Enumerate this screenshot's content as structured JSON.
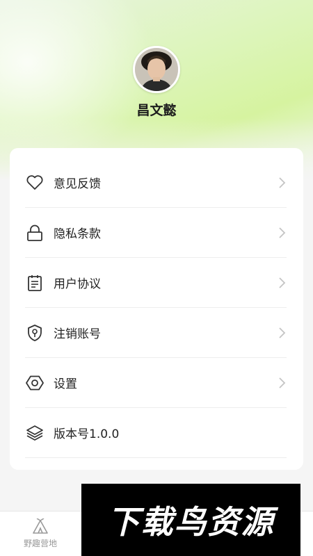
{
  "profile": {
    "name": "昌文懿"
  },
  "menu": [
    {
      "label": "意见反馈",
      "icon": "heart-icon",
      "chevron": true
    },
    {
      "label": "隐私条款",
      "icon": "lock-icon",
      "chevron": true
    },
    {
      "label": "用户协议",
      "icon": "document-icon",
      "chevron": true
    },
    {
      "label": "注销账号",
      "icon": "shield-key-icon",
      "chevron": true
    },
    {
      "label": "设置",
      "icon": "hexagon-settings-icon",
      "chevron": true
    },
    {
      "label": "版本号1.0.0",
      "icon": "layers-icon",
      "chevron": false
    }
  ],
  "tabbar": {
    "tabs": [
      {
        "label": "野趣营地",
        "icon": "tent-icon"
      }
    ]
  },
  "watermark": {
    "text": "下载鸟资源"
  },
  "colors": {
    "hero_start": "#e8f4e0",
    "hero_mid": "#d6f3a0",
    "card": "#ffffff",
    "tab_inactive": "#999999"
  }
}
